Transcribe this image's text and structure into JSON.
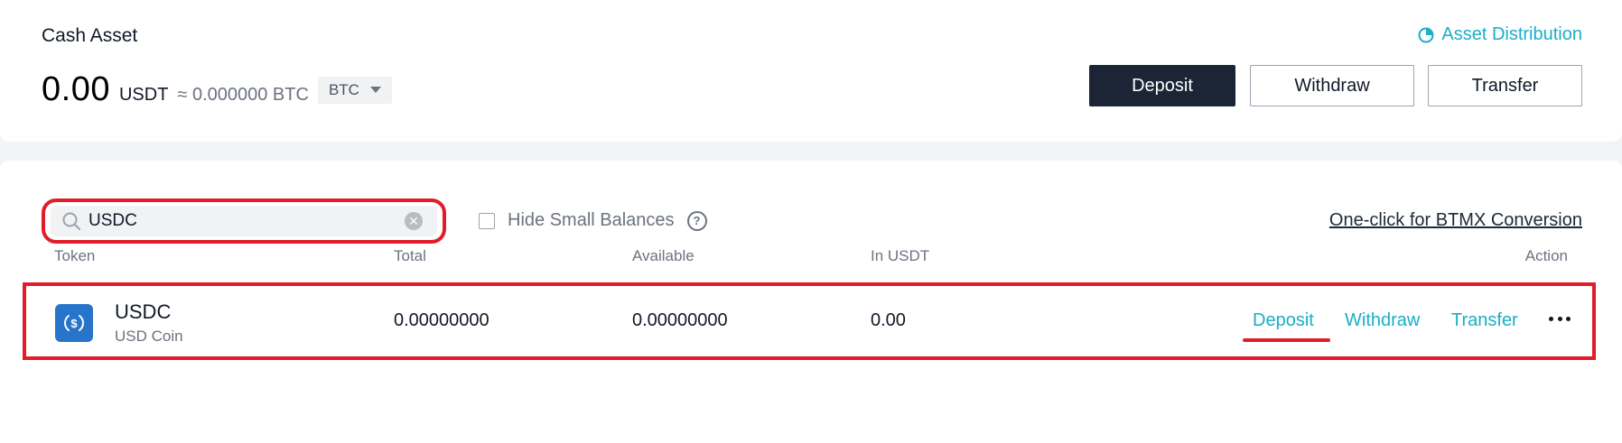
{
  "summary": {
    "title": "Cash Asset",
    "balance": "0.00",
    "unit": "USDT",
    "approx": "≈ 0.000000 BTC",
    "currency_selected": "BTC",
    "asset_distribution": "Asset Distribution",
    "buttons": {
      "deposit": "Deposit",
      "withdraw": "Withdraw",
      "transfer": "Transfer"
    }
  },
  "filters": {
    "search_value": "USDC",
    "search_placeholder": "",
    "hide_small_label": "Hide Small Balances",
    "hide_small_checked": false,
    "btmx_link": "One-click for BTMX Conversion"
  },
  "table": {
    "headers": {
      "token": "Token",
      "total": "Total",
      "available": "Available",
      "in_usdt": "In USDT",
      "action": "Action"
    },
    "rows": [
      {
        "symbol": "USDC",
        "name": "USD Coin",
        "total": "0.00000000",
        "available": "0.00000000",
        "in_usdt": "0.00",
        "actions": {
          "deposit": "Deposit",
          "withdraw": "Withdraw",
          "transfer": "Transfer"
        }
      }
    ]
  },
  "colors": {
    "accent": "#1aaec7",
    "primary_button": "#1b2536",
    "highlight": "#e11d2a",
    "usdc_brand": "#2775ca"
  },
  "icons": [
    "pie-chart-icon",
    "caret-down-icon",
    "search-icon",
    "clear-icon",
    "help-icon",
    "usdc-logo-icon",
    "more-icon"
  ]
}
